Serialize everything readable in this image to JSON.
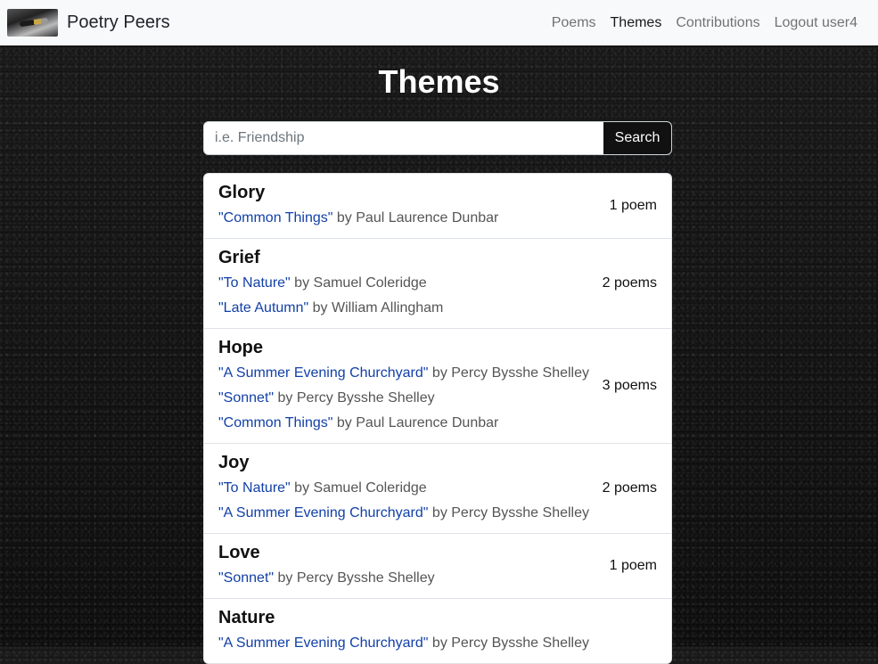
{
  "nav": {
    "brand": "Poetry Peers",
    "links": [
      "Poems",
      "Themes",
      "Contributions",
      "Logout user4"
    ],
    "active": "Themes"
  },
  "page": {
    "title": "Themes"
  },
  "search": {
    "placeholder": "i.e. Friendship",
    "value": "",
    "button": "Search"
  },
  "themes": [
    {
      "name": "Glory",
      "count": "1 poem",
      "poems": [
        {
          "title": "\"Common Things\"",
          "author": " by Paul Laurence Dunbar"
        }
      ]
    },
    {
      "name": "Grief",
      "count": "2 poems",
      "poems": [
        {
          "title": "\"To Nature\"",
          "author": " by Samuel Coleridge"
        },
        {
          "title": "\"Late Autumn\"",
          "author": " by William Allingham"
        }
      ]
    },
    {
      "name": "Hope",
      "count": "3 poems",
      "poems": [
        {
          "title": "\"A Summer Evening Churchyard\"",
          "author": " by Percy Bysshe Shelley"
        },
        {
          "title": "\"Sonnet\"",
          "author": " by Percy Bysshe Shelley"
        },
        {
          "title": "\"Common Things\"",
          "author": " by Paul Laurence Dunbar"
        }
      ]
    },
    {
      "name": "Joy",
      "count": "2 poems",
      "poems": [
        {
          "title": "\"To Nature\"",
          "author": " by Samuel Coleridge"
        },
        {
          "title": "\"A Summer Evening Churchyard\"",
          "author": " by Percy Bysshe Shelley"
        }
      ]
    },
    {
      "name": "Love",
      "count": "1 poem",
      "poems": [
        {
          "title": "\"Sonnet\"",
          "author": " by Percy Bysshe Shelley"
        }
      ]
    },
    {
      "name": "Nature",
      "count": "",
      "poems": [
        {
          "title": "\"A Summer Evening Churchyard\"",
          "author": " by Percy Bysshe Shelley"
        }
      ]
    }
  ]
}
